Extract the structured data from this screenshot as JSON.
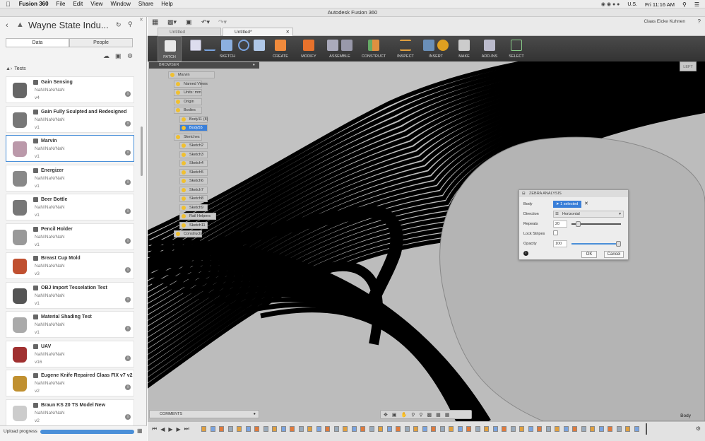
{
  "menubar": {
    "app": "Fusion 360",
    "items": [
      "File",
      "Edit",
      "View",
      "Window",
      "Share",
      "Help"
    ],
    "locale": "U.S.",
    "clock": "Fri 11:16 AM"
  },
  "window": {
    "title": "Autodesk Fusion 360",
    "user": "Claas Eicke Kuhnen"
  },
  "data_panel": {
    "project": "Wayne State Indu...",
    "tabs": [
      "Data",
      "People"
    ],
    "breadcrumb": "Tests",
    "items": [
      {
        "name": "Gain Sensing",
        "date": "NaN/NaN/NaN",
        "version": "v4"
      },
      {
        "name": "Gain Fully Sculpted and Redesigned",
        "date": "NaN/NaN/NaN",
        "version": "v1"
      },
      {
        "name": "Marvin",
        "date": "NaN/NaN/NaN",
        "version": "v1",
        "selected": true
      },
      {
        "name": "Energizer",
        "date": "NaN/NaN/NaN",
        "version": "v1"
      },
      {
        "name": "Beer Bottle",
        "date": "NaN/NaN/NaN",
        "version": "v1"
      },
      {
        "name": "Pencil Holder",
        "date": "NaN/NaN/NaN",
        "version": "v1"
      },
      {
        "name": "Breast Cup Mold",
        "date": "NaN/NaN/NaN",
        "version": "v3"
      },
      {
        "name": "OBJ Import Tesselation Test",
        "date": "NaN/NaN/NaN",
        "version": "v1"
      },
      {
        "name": "Material Shading Test",
        "date": "NaN/NaN/NaN",
        "version": "v1"
      },
      {
        "name": "UAV",
        "date": "NaN/NaN/NaN",
        "version": "v16"
      },
      {
        "name": "Eugene Knife Repaired Claas FIX v7 v2",
        "date": "NaN/NaN/NaN",
        "version": "v2"
      },
      {
        "name": "Braun KS 20 TS Model New",
        "date": "NaN/NaN/NaN",
        "version": "v2"
      }
    ],
    "upload_label": "Upload progress"
  },
  "doc_tabs": [
    "Untitled",
    "Untitled*"
  ],
  "toolbar": {
    "workspace": "PATCH",
    "groups": [
      "SKETCH",
      "CREATE",
      "MODIFY",
      "ASSEMBLE",
      "CONSTRUCT",
      "INSPECT",
      "INSERT",
      "MAKE",
      "ADD-INS",
      "SELECT"
    ]
  },
  "browser": {
    "header": "BROWSER",
    "rows": [
      {
        "label": "Marvin"
      },
      {
        "label": "Named Views"
      },
      {
        "label": "Units: mm"
      },
      {
        "label": "Origin"
      },
      {
        "label": "Bodies"
      },
      {
        "label": "Body11 (8)"
      },
      {
        "label": "Body55"
      },
      {
        "label": "Sketches"
      },
      {
        "label": "Sketch2"
      },
      {
        "label": "Sketch3"
      },
      {
        "label": "Sketch4"
      },
      {
        "label": "Sketch5"
      },
      {
        "label": "Sketch6"
      },
      {
        "label": "Sketch7"
      },
      {
        "label": "Sketch8"
      },
      {
        "label": "Sketch9"
      },
      {
        "label": "Rail Helpers"
      },
      {
        "label": "Sketch11"
      },
      {
        "label": "Construction"
      }
    ]
  },
  "zebra": {
    "title": "ZEBRA ANALYSIS",
    "body_label": "Body",
    "body_value": "1 selected",
    "direction_label": "Direction",
    "direction_value": "Horizontal",
    "repeats_label": "Repeats",
    "repeats_value": "20",
    "repeats_fraction": 0.1,
    "lock_label": "Lock Stripes",
    "opacity_label": "Opacity",
    "opacity_value": "100",
    "opacity_fraction": 1.0,
    "ok": "OK",
    "cancel": "Cancel"
  },
  "viewcube": "LEFT",
  "comments": "COMMENTS",
  "status_right": "Body"
}
